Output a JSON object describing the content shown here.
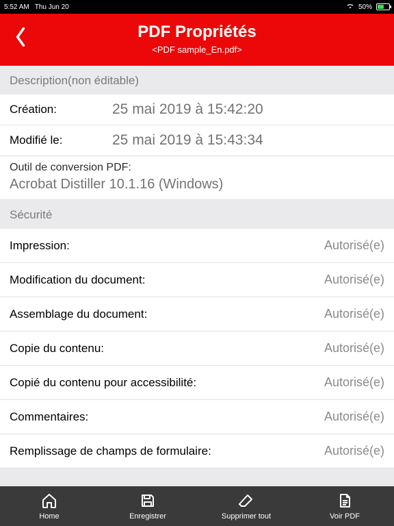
{
  "statusbar": {
    "time": "5:52 AM",
    "date": "Thu Jun 20",
    "battery": "50%"
  },
  "header": {
    "title": "PDF Propriétés",
    "subtitle": "<PDF sample_En.pdf>"
  },
  "sections": {
    "desc_header": "Description(non éditable)",
    "creation_label": "Création:",
    "creation_value": "25 mai 2019 à 15:42:20",
    "modified_label": "Modifié le:",
    "modified_value": "25 mai 2019 à 15:43:34",
    "tool_label": "Outil de conversion PDF:",
    "tool_value": "Acrobat Distiller 10.1.16 (Windows)",
    "security_header": "Sécurité"
  },
  "security": [
    {
      "label": "Impression:",
      "value": "Autorisé(e)"
    },
    {
      "label": "Modification du document:",
      "value": "Autorisé(e)"
    },
    {
      "label": "Assemblage du document:",
      "value": "Autorisé(e)"
    },
    {
      "label": "Copie du contenu:",
      "value": "Autorisé(e)"
    },
    {
      "label": "Copié du contenu pour accessibilité:",
      "value": "Autorisé(e)"
    },
    {
      "label": "Commentaires:",
      "value": "Autorisé(e)"
    },
    {
      "label": "Remplissage de champs de formulaire:",
      "value": "Autorisé(e)"
    }
  ],
  "toolbar": {
    "home": "Home",
    "save": "Enregistrer",
    "deleteall": "Supprimer tout",
    "view": "Voir PDF"
  }
}
